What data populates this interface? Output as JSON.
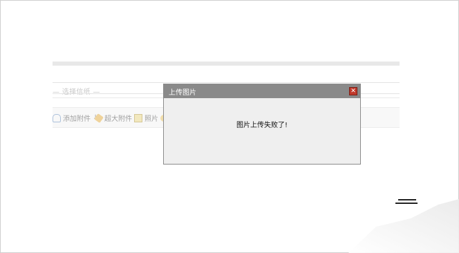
{
  "editor": {
    "select_placeholder": "— 选择信纸 —",
    "toolbar": [
      {
        "label": "添加附件",
        "suffix": "↓",
        "icon": "paperclip-icon"
      },
      {
        "label": "超大附件",
        "icon": "large-attachment-icon"
      },
      {
        "label": "照片",
        "icon": "photo-icon"
      }
    ]
  },
  "dialog": {
    "title": "上传图片",
    "close_symbol": "✕",
    "message": "图片上传失败了!"
  },
  "colors": {
    "dialog_title_bg": "#8a8a8a",
    "close_button": "#c0392b",
    "dialog_body_bg": "#efefef"
  }
}
